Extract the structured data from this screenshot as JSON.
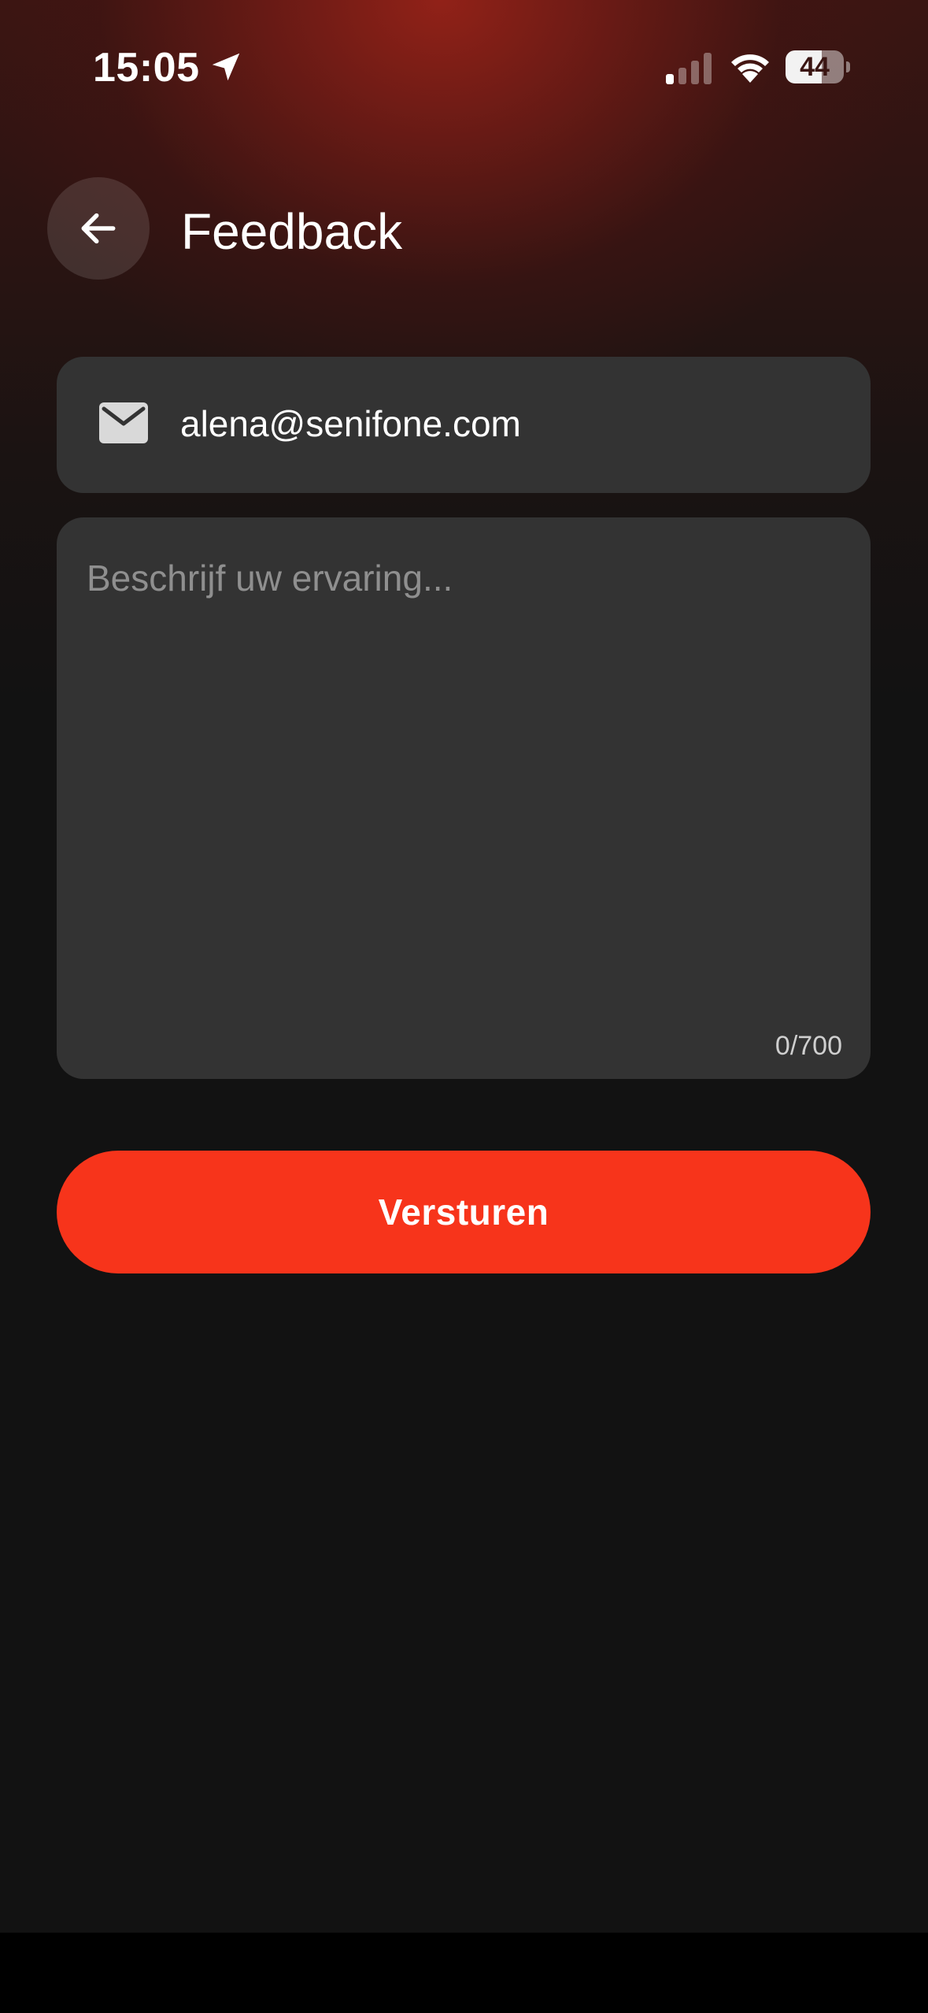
{
  "status_bar": {
    "time": "15:05",
    "battery": "44",
    "icons": [
      "location-arrow-icon",
      "cellular-signal-icon",
      "wifi-icon",
      "battery-icon"
    ]
  },
  "header": {
    "title": "Feedback",
    "back_icon": "arrow-left-icon"
  },
  "form": {
    "email_icon": "envelope-icon",
    "email_value": "alena@senifone.com",
    "message_placeholder": "Beschrijf uw ervaring...",
    "char_counter": "0/700",
    "submit_label": "Versturen"
  },
  "colors": {
    "accent": "#f7341b",
    "field_background": "#333333",
    "background": "#121212",
    "header_glow": "#962218"
  }
}
